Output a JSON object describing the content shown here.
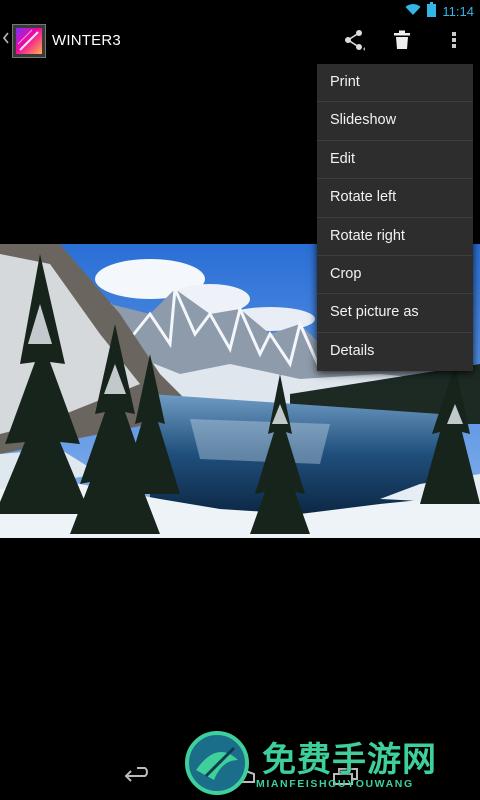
{
  "status_bar": {
    "time": "11:14",
    "icons": [
      "wifi-icon",
      "battery-icon"
    ]
  },
  "action_bar": {
    "title": "WINTER3",
    "actions": [
      "share-icon",
      "delete-icon",
      "overflow-menu-icon"
    ]
  },
  "overflow_menu": {
    "items": [
      {
        "label": "Print"
      },
      {
        "label": "Slideshow"
      },
      {
        "label": "Edit"
      },
      {
        "label": "Rotate left"
      },
      {
        "label": "Rotate right"
      },
      {
        "label": "Crop"
      },
      {
        "label": "Set picture as"
      },
      {
        "label": "Details"
      }
    ]
  },
  "photo": {
    "subject": "snowy mountain lake"
  },
  "nav_bar": {
    "buttons": [
      "back-icon",
      "home-icon",
      "recent-apps-icon"
    ]
  },
  "watermark": {
    "text": "免费手游网",
    "subtext": "MIANFEISHOUYOUWANG"
  },
  "colors": {
    "accent": "#33b5e5",
    "menu_bg": "#2d2d2d",
    "watermark": "#3ecf9b"
  }
}
